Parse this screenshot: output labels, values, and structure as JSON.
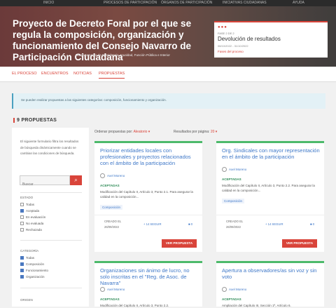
{
  "top_nav": {
    "items": [
      "INICIO",
      "PROCESOS DE PARTICIPACIÓN",
      "ÓRGANOS DE PARTICIPACIÓN",
      "INICIATIVAS CIUDADANAS",
      "AYUDA"
    ]
  },
  "hero": {
    "title": "Proyecto de Decreto Foral por el que se regula la composición, organización y funcionamiento del Consejo Navarro de Participación Ciudadana",
    "department": "Departamento de Presidencia, Igualdad, Función Pública e Interior",
    "phase": {
      "step": "FASE 2 DE 2",
      "name": "Devolución de resultados",
      "dates": "08/10/2022 - 31/10/2022",
      "link": "Fases del proceso"
    }
  },
  "tabs": [
    {
      "label": "EL PROCESO",
      "active": false
    },
    {
      "label": "ENCUENTROS",
      "active": false
    },
    {
      "label": "NOTICIAS",
      "active": false
    },
    {
      "label": "PROPUESTAS",
      "active": true
    }
  ],
  "callout": {
    "text": "Se pueden realizar propuestas a las siguientes categorías: composición, funcionamiento y organización."
  },
  "proposals_count": "9 PROPUESTAS",
  "filters": {
    "help": "El siguiente formulario filtra los resultados de búsqueda dinámicamente cuando se cambian las condiciones de búsqueda.",
    "search_placeholder": "Buscar",
    "estado": {
      "label": "ESTADO",
      "options": [
        {
          "label": "Todas",
          "checked": false
        },
        {
          "label": "Aceptada",
          "checked": true
        },
        {
          "label": "En evaluación",
          "checked": false
        },
        {
          "label": "No evaluada",
          "checked": false
        },
        {
          "label": "Rechazada",
          "checked": false
        }
      ]
    },
    "categoria": {
      "label": "CATEGORÍA",
      "options": [
        {
          "label": "Todas",
          "checked": true
        },
        {
          "label": "Composición",
          "checked": true
        },
        {
          "label": "Funcionamiento",
          "checked": true
        },
        {
          "label": "Organización",
          "checked": true
        }
      ]
    },
    "origen": {
      "label": "ORIGEN"
    }
  },
  "sort": {
    "label": "Ordenar propuestas por:",
    "value": "Aleatorio",
    "per_page_label": "Resultados por página:",
    "per_page_value": "20"
  },
  "cards": [
    {
      "title": "Priorizar entidades locales con profesionales y proyectos relacionados con el ámbito de la participación",
      "author": "Axel Moreno",
      "status": "ACEPTADAS",
      "summary": "Modificación del Capítulo II, Artículo 3, Punto 2.1. Para asegurar la calidad en la composición...",
      "tag": "Composición",
      "created_label": "CREADO EL",
      "date": "26/09/2022",
      "follow": "+ 14 SEGUIR",
      "comments": "0",
      "button": "VER PROPUESTA"
    },
    {
      "title": "Org. Sindicales con mayor representación en el ámbito de la participación",
      "author": "Axel Moreno",
      "status": "ACEPTADAS",
      "summary": "Modificación del Capítulo II, Artículo 3, Punto 2.2. Para asegurar la calidad en la composición...",
      "tag": "Composición",
      "created_label": "CREADO EL",
      "date": "26/09/2022",
      "follow": "+ 14 SEGUIR",
      "comments": "0",
      "button": "VER PROPUESTA"
    },
    {
      "title": "Organizaciones sin ánimo de lucro, no solo inscritas en el \"Reg. de Asoc. de Navarra\"",
      "author": "Axel Moreno",
      "status": "ACEPTADAS",
      "summary": "Modificación del Capítulo II, Artículo 3, Punto 2.2."
    },
    {
      "title": "Apertura a observadores/as sin voz y sin voto",
      "author": "Axel Moreno",
      "status": "ACEPTADAS",
      "summary": "Ampliación del Capítulo III, Sección 1ª, Artículo 6."
    }
  ]
}
